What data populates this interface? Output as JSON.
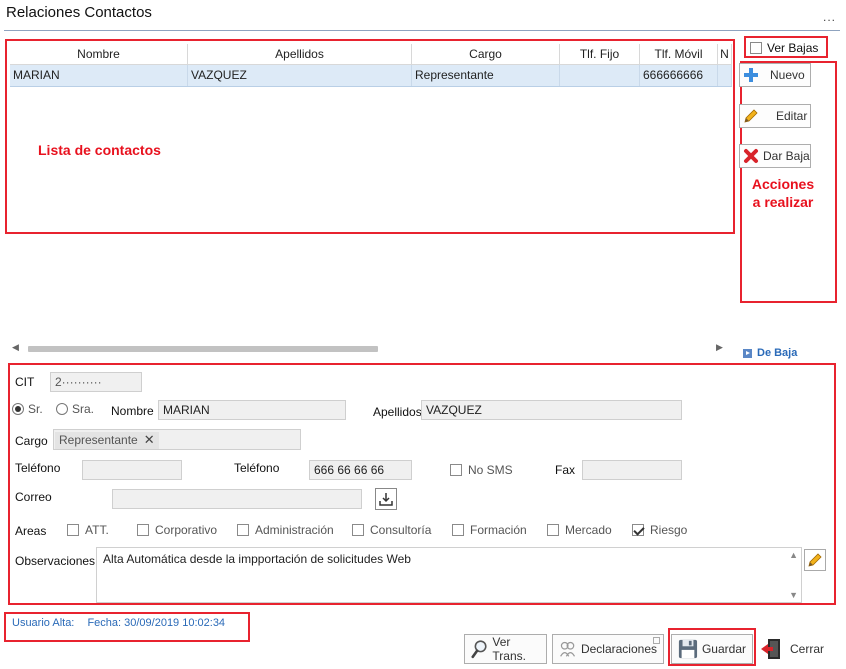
{
  "window": {
    "title": "Relaciones Contactos",
    "menu_dots": "..."
  },
  "grid": {
    "columns": [
      "Nombre",
      "Apellidos",
      "Cargo",
      "Tlf. Fijo",
      "Tlf. Móvil",
      "N"
    ],
    "rows": [
      {
        "nombre": "MARIAN",
        "apellidos": "VAZQUEZ",
        "cargo": "Representante",
        "tlf_fijo": "",
        "tlf_movil": "666666666",
        "n": ""
      }
    ]
  },
  "annotations": {
    "lista": "Lista de contactos",
    "acciones_1": "Acciones",
    "acciones_2": "a realizar"
  },
  "actions": {
    "ver_bajas": "Ver Bajas",
    "ver_bajas_checked": false,
    "nuevo": "Nuevo",
    "editar": "Editar",
    "dar_baja": "Dar Baja"
  },
  "de_baja": "De Baja",
  "form": {
    "cit_label": "CIT",
    "cit_value": "2··········",
    "sr": "Sr.",
    "sra": "Sra.",
    "nombre_label": "Nombre",
    "nombre_value": "MARIAN",
    "apellidos_label": "Apellidos",
    "apellidos_value": "VAZQUEZ",
    "cargo_label": "Cargo",
    "cargo_tag": "Representante",
    "telefono_label": "Teléfono",
    "telefono_value": "",
    "telefono2_label": "Teléfono",
    "telefono2_value": "666 66 66 66",
    "no_sms": "No SMS",
    "fax_label": "Fax",
    "fax_value": "",
    "correo_label": "Correo",
    "correo_value": "",
    "areas_label": "Areas",
    "areas": [
      {
        "label": "ATT.",
        "checked": false
      },
      {
        "label": "Corporativo",
        "checked": false
      },
      {
        "label": "Administración",
        "checked": false
      },
      {
        "label": "Consultoría",
        "checked": false
      },
      {
        "label": "Formación",
        "checked": false
      },
      {
        "label": "Mercado",
        "checked": false
      },
      {
        "label": "Riesgo",
        "checked": true
      }
    ],
    "observaciones_label": "Observaciones",
    "observaciones_value": "Alta Automática desde la impportación de solicitudes Web"
  },
  "footer": {
    "usuario_alta": "Usuario Alta:",
    "fecha": "Fecha: 30/09/2019 10:02:34"
  },
  "bottom_buttons": {
    "ver_trans": "Ver Trans.",
    "declaraciones": "Declaraciones",
    "guardar": "Guardar",
    "cerrar": "Cerrar"
  },
  "colors": {
    "annotation_red": "#e8232f",
    "selected_row": "#ddeaf7",
    "link_blue": "#2a6ab8"
  }
}
